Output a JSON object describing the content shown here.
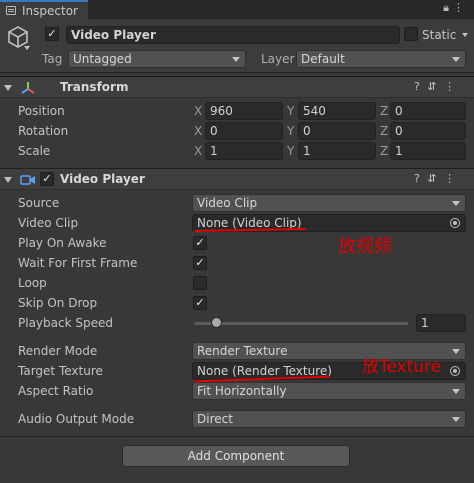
{
  "tab": {
    "title": "Inspector"
  },
  "object": {
    "active": "✓",
    "name": "Video Player",
    "static_label": "Static",
    "tag_label": "Tag",
    "tag_value": "Untagged",
    "layer_label": "Layer",
    "layer_value": "Default"
  },
  "transform": {
    "title": "Transform",
    "rows": [
      {
        "label": "Position",
        "x": "960",
        "y": "540",
        "z": "0"
      },
      {
        "label": "Rotation",
        "x": "0",
        "y": "0",
        "z": "0"
      },
      {
        "label": "Scale",
        "x": "1",
        "y": "1",
        "z": "1"
      }
    ],
    "axes": {
      "x": "X",
      "y": "Y",
      "z": "Z"
    }
  },
  "video_player": {
    "title": "Video Player",
    "enabled": "✓",
    "source_label": "Source",
    "source_value": "Video Clip",
    "clip_label": "Video Clip",
    "clip_value": "None (Video Clip)",
    "play_on_awake_label": "Play On Awake",
    "play_on_awake": "✓",
    "wait_first_frame_label": "Wait For First Frame",
    "wait_first_frame": "✓",
    "loop_label": "Loop",
    "loop": "",
    "skip_on_drop_label": "Skip On Drop",
    "skip_on_drop": "✓",
    "playback_speed_label": "Playback Speed",
    "playback_speed": "1",
    "playback_speed_fraction": 0.0,
    "render_mode_label": "Render Mode",
    "render_mode_value": "Render Texture",
    "target_texture_label": "Target Texture",
    "target_texture_value": "None (Render Texture)",
    "aspect_ratio_label": "Aspect Ratio",
    "aspect_ratio_value": "Fit Horizontally",
    "audio_output_label": "Audio Output Mode",
    "audio_output_value": "Direct"
  },
  "annotations": {
    "clip_note": "放视频",
    "texture_note": "放Texture",
    "color": "#e00000"
  },
  "add_component_label": "Add Component"
}
